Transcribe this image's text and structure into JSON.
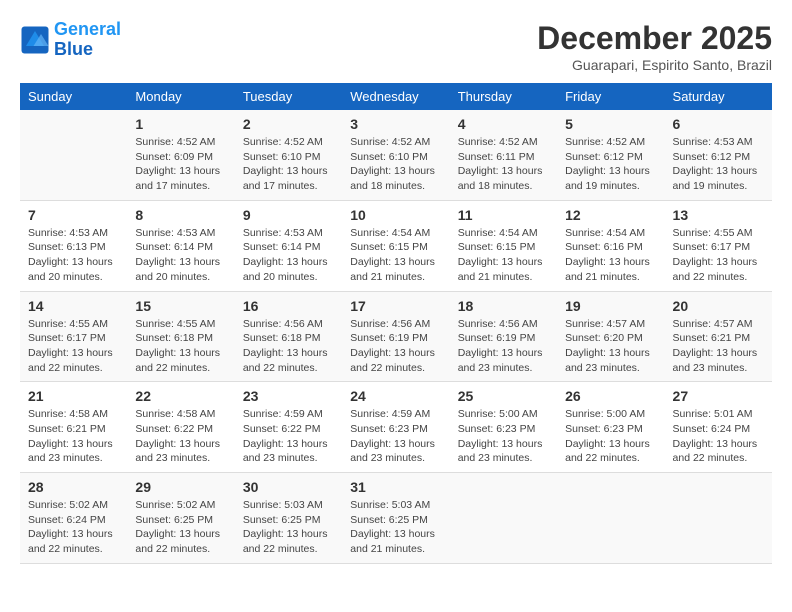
{
  "header": {
    "logo_line1": "General",
    "logo_line2": "Blue",
    "month": "December 2025",
    "location": "Guarapari, Espirito Santo, Brazil"
  },
  "weekdays": [
    "Sunday",
    "Monday",
    "Tuesday",
    "Wednesday",
    "Thursday",
    "Friday",
    "Saturday"
  ],
  "weeks": [
    [
      {
        "day": "",
        "info": ""
      },
      {
        "day": "1",
        "info": "Sunrise: 4:52 AM\nSunset: 6:09 PM\nDaylight: 13 hours\nand 17 minutes."
      },
      {
        "day": "2",
        "info": "Sunrise: 4:52 AM\nSunset: 6:10 PM\nDaylight: 13 hours\nand 17 minutes."
      },
      {
        "day": "3",
        "info": "Sunrise: 4:52 AM\nSunset: 6:10 PM\nDaylight: 13 hours\nand 18 minutes."
      },
      {
        "day": "4",
        "info": "Sunrise: 4:52 AM\nSunset: 6:11 PM\nDaylight: 13 hours\nand 18 minutes."
      },
      {
        "day": "5",
        "info": "Sunrise: 4:52 AM\nSunset: 6:12 PM\nDaylight: 13 hours\nand 19 minutes."
      },
      {
        "day": "6",
        "info": "Sunrise: 4:53 AM\nSunset: 6:12 PM\nDaylight: 13 hours\nand 19 minutes."
      }
    ],
    [
      {
        "day": "7",
        "info": "Sunrise: 4:53 AM\nSunset: 6:13 PM\nDaylight: 13 hours\nand 20 minutes."
      },
      {
        "day": "8",
        "info": "Sunrise: 4:53 AM\nSunset: 6:14 PM\nDaylight: 13 hours\nand 20 minutes."
      },
      {
        "day": "9",
        "info": "Sunrise: 4:53 AM\nSunset: 6:14 PM\nDaylight: 13 hours\nand 20 minutes."
      },
      {
        "day": "10",
        "info": "Sunrise: 4:54 AM\nSunset: 6:15 PM\nDaylight: 13 hours\nand 21 minutes."
      },
      {
        "day": "11",
        "info": "Sunrise: 4:54 AM\nSunset: 6:15 PM\nDaylight: 13 hours\nand 21 minutes."
      },
      {
        "day": "12",
        "info": "Sunrise: 4:54 AM\nSunset: 6:16 PM\nDaylight: 13 hours\nand 21 minutes."
      },
      {
        "day": "13",
        "info": "Sunrise: 4:55 AM\nSunset: 6:17 PM\nDaylight: 13 hours\nand 22 minutes."
      }
    ],
    [
      {
        "day": "14",
        "info": "Sunrise: 4:55 AM\nSunset: 6:17 PM\nDaylight: 13 hours\nand 22 minutes."
      },
      {
        "day": "15",
        "info": "Sunrise: 4:55 AM\nSunset: 6:18 PM\nDaylight: 13 hours\nand 22 minutes."
      },
      {
        "day": "16",
        "info": "Sunrise: 4:56 AM\nSunset: 6:18 PM\nDaylight: 13 hours\nand 22 minutes."
      },
      {
        "day": "17",
        "info": "Sunrise: 4:56 AM\nSunset: 6:19 PM\nDaylight: 13 hours\nand 22 minutes."
      },
      {
        "day": "18",
        "info": "Sunrise: 4:56 AM\nSunset: 6:19 PM\nDaylight: 13 hours\nand 23 minutes."
      },
      {
        "day": "19",
        "info": "Sunrise: 4:57 AM\nSunset: 6:20 PM\nDaylight: 13 hours\nand 23 minutes."
      },
      {
        "day": "20",
        "info": "Sunrise: 4:57 AM\nSunset: 6:21 PM\nDaylight: 13 hours\nand 23 minutes."
      }
    ],
    [
      {
        "day": "21",
        "info": "Sunrise: 4:58 AM\nSunset: 6:21 PM\nDaylight: 13 hours\nand 23 minutes."
      },
      {
        "day": "22",
        "info": "Sunrise: 4:58 AM\nSunset: 6:22 PM\nDaylight: 13 hours\nand 23 minutes."
      },
      {
        "day": "23",
        "info": "Sunrise: 4:59 AM\nSunset: 6:22 PM\nDaylight: 13 hours\nand 23 minutes."
      },
      {
        "day": "24",
        "info": "Sunrise: 4:59 AM\nSunset: 6:23 PM\nDaylight: 13 hours\nand 23 minutes."
      },
      {
        "day": "25",
        "info": "Sunrise: 5:00 AM\nSunset: 6:23 PM\nDaylight: 13 hours\nand 23 minutes."
      },
      {
        "day": "26",
        "info": "Sunrise: 5:00 AM\nSunset: 6:23 PM\nDaylight: 13 hours\nand 22 minutes."
      },
      {
        "day": "27",
        "info": "Sunrise: 5:01 AM\nSunset: 6:24 PM\nDaylight: 13 hours\nand 22 minutes."
      }
    ],
    [
      {
        "day": "28",
        "info": "Sunrise: 5:02 AM\nSunset: 6:24 PM\nDaylight: 13 hours\nand 22 minutes."
      },
      {
        "day": "29",
        "info": "Sunrise: 5:02 AM\nSunset: 6:25 PM\nDaylight: 13 hours\nand 22 minutes."
      },
      {
        "day": "30",
        "info": "Sunrise: 5:03 AM\nSunset: 6:25 PM\nDaylight: 13 hours\nand 22 minutes."
      },
      {
        "day": "31",
        "info": "Sunrise: 5:03 AM\nSunset: 6:25 PM\nDaylight: 13 hours\nand 21 minutes."
      },
      {
        "day": "",
        "info": ""
      },
      {
        "day": "",
        "info": ""
      },
      {
        "day": "",
        "info": ""
      }
    ]
  ]
}
